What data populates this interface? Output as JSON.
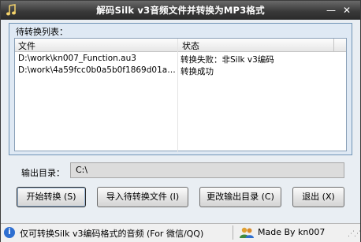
{
  "window": {
    "title": "解码Silk v3音频文件并转换为MP3格式",
    "minimize_glyph": "—",
    "close_glyph": "✕"
  },
  "group": {
    "label": "待转换列表："
  },
  "table": {
    "columns": [
      "文件",
      "状态"
    ],
    "rows": [
      {
        "file": "D:\\work\\kn007_Function.au3",
        "status": "转换失败：非Silk v3编码"
      },
      {
        "file": "D:\\work\\4a59fcc0b0a5b0f1869d01ae...",
        "status": "转换成功"
      }
    ]
  },
  "output": {
    "label": "输出目录：",
    "path": "C:\\"
  },
  "buttons": {
    "start": "开始转换 (S)",
    "import": "导入待转换文件 (I)",
    "change_dir": "更改输出目录 (C)",
    "exit": "退出 (X)"
  },
  "statusbar": {
    "left_text": "仅可转换Silk v3编码格式的音频 (For 微信/QQ)",
    "right_text": "Made By kn007",
    "info_icon": "info-icon",
    "users_icon": "users-icon"
  }
}
